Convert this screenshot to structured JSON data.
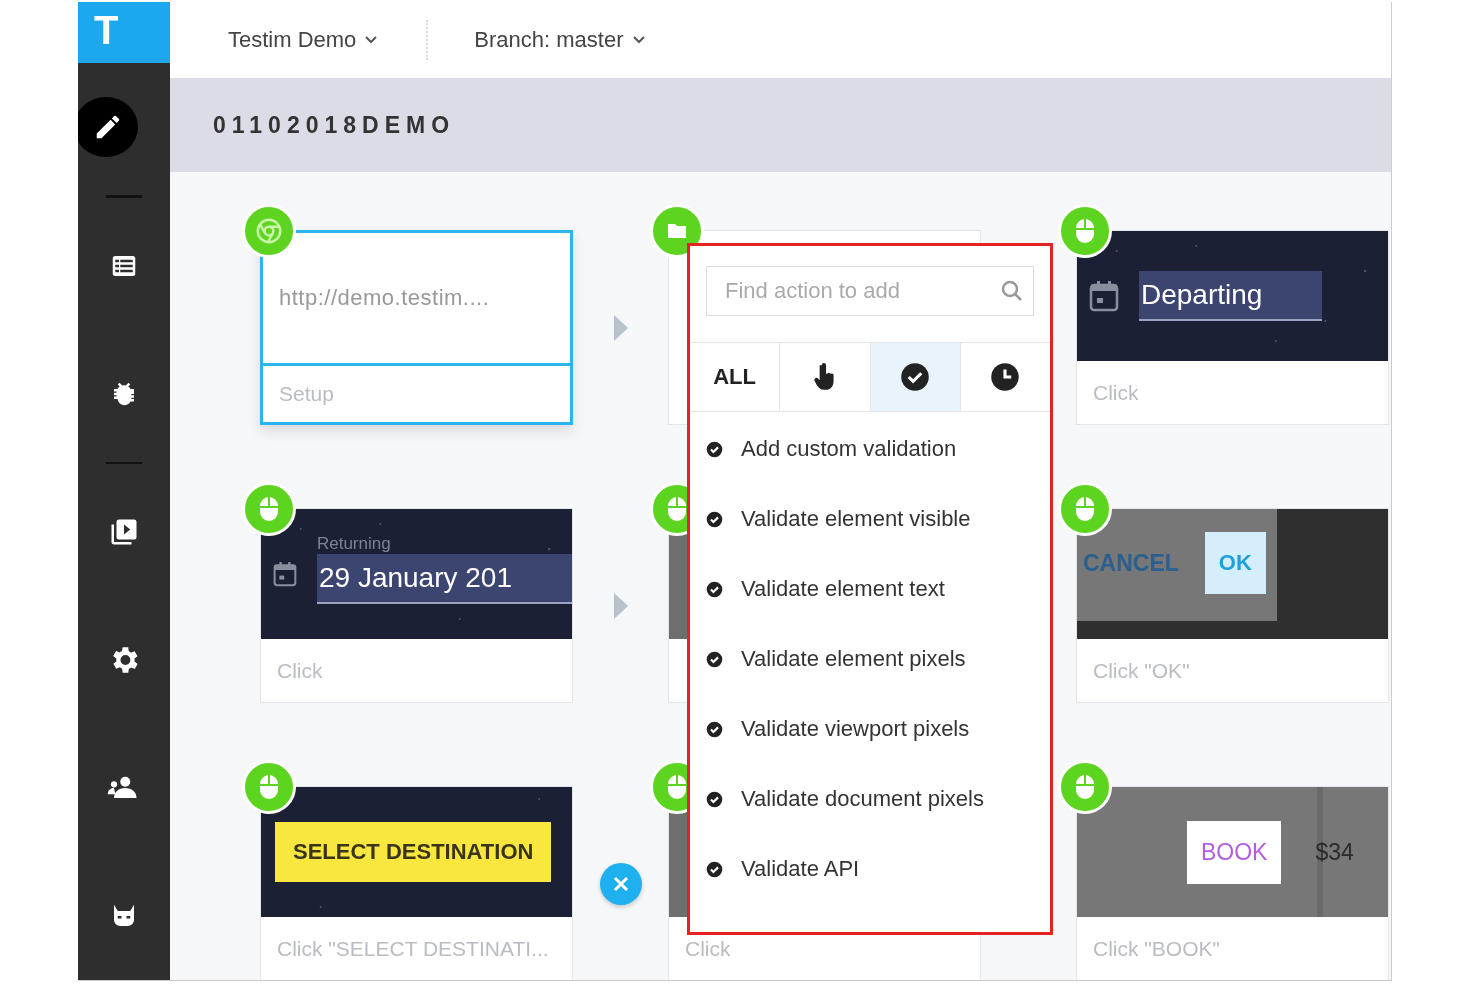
{
  "logo": "T",
  "top_bar": {
    "project": "Testim Demo",
    "branch": "Branch: master"
  },
  "sidebar": {
    "groups": [
      [
        {
          "kind": "edit",
          "selected": true
        }
      ],
      [
        {
          "kind": "list",
          "selected": false
        },
        {
          "kind": "bug",
          "selected": false
        }
      ],
      [
        {
          "kind": "play",
          "selected": false
        },
        {
          "kind": "settings",
          "selected": false
        },
        {
          "kind": "people",
          "selected": false
        },
        {
          "kind": "mask",
          "selected": false
        }
      ]
    ]
  },
  "test_name": "01102018DEMO",
  "rows": [
    {
      "connector": {
        "kind": "arrow"
      },
      "steps": [
        {
          "badge": {
            "kind": "browser"
          },
          "selected": true,
          "preview": {
            "kind": "url",
            "text": "http://demo.testim...."
          },
          "caption": "Setup"
        },
        {
          "badge": {
            "kind": "folder"
          },
          "selected": false,
          "preview": {
            "kind": "blank"
          }
        },
        {
          "badge": {
            "kind": "mouse"
          },
          "selected": false,
          "preview": {
            "kind": "date",
            "value": "Departing"
          },
          "caption": "Click"
        }
      ]
    },
    {
      "connector": {
        "kind": "arrow"
      },
      "steps": [
        {
          "badge": {
            "kind": "mouse"
          },
          "selected": false,
          "preview": {
            "kind": "date",
            "label": "Returning",
            "value": "29 January 201"
          },
          "caption": "Click"
        },
        {
          "badge": {
            "kind": "mouse"
          },
          "selected": false,
          "preview": {
            "kind": "screen"
          }
        },
        {
          "badge": {
            "kind": "mouse"
          },
          "selected": false,
          "preview": {
            "kind": "dialog",
            "cancel": "CANCEL",
            "ok": "OK"
          },
          "caption": "Click \"OK\""
        }
      ]
    },
    {
      "connector": {
        "kind": "delete"
      },
      "steps": [
        {
          "badge": {
            "kind": "mouse"
          },
          "selected": false,
          "preview": {
            "kind": "button",
            "text": "SELECT DESTINATION"
          },
          "caption": "Click \"SELECT DESTINATI..."
        },
        {
          "badge": {
            "kind": "mouse"
          },
          "selected": false,
          "preview": {
            "kind": "screen"
          },
          "caption": "Click"
        },
        {
          "badge": {
            "kind": "mouse"
          },
          "selected": false,
          "preview": {
            "kind": "book",
            "text": "BOOK",
            "price": "$34"
          },
          "caption": "Click \"BOOK\""
        }
      ]
    }
  ],
  "action_picker": {
    "placeholder": "Find action to add",
    "tabs": [
      {
        "kind": "all",
        "label": "ALL",
        "selected": false
      },
      {
        "kind": "touch",
        "selected": false
      },
      {
        "kind": "validate",
        "selected": true
      },
      {
        "kind": "wait",
        "selected": false
      }
    ],
    "items": [
      "Add custom validation",
      "Validate element visible",
      "Validate element text",
      "Validate element pixels",
      "Validate viewport pixels",
      "Validate document pixels",
      "Validate API"
    ]
  }
}
